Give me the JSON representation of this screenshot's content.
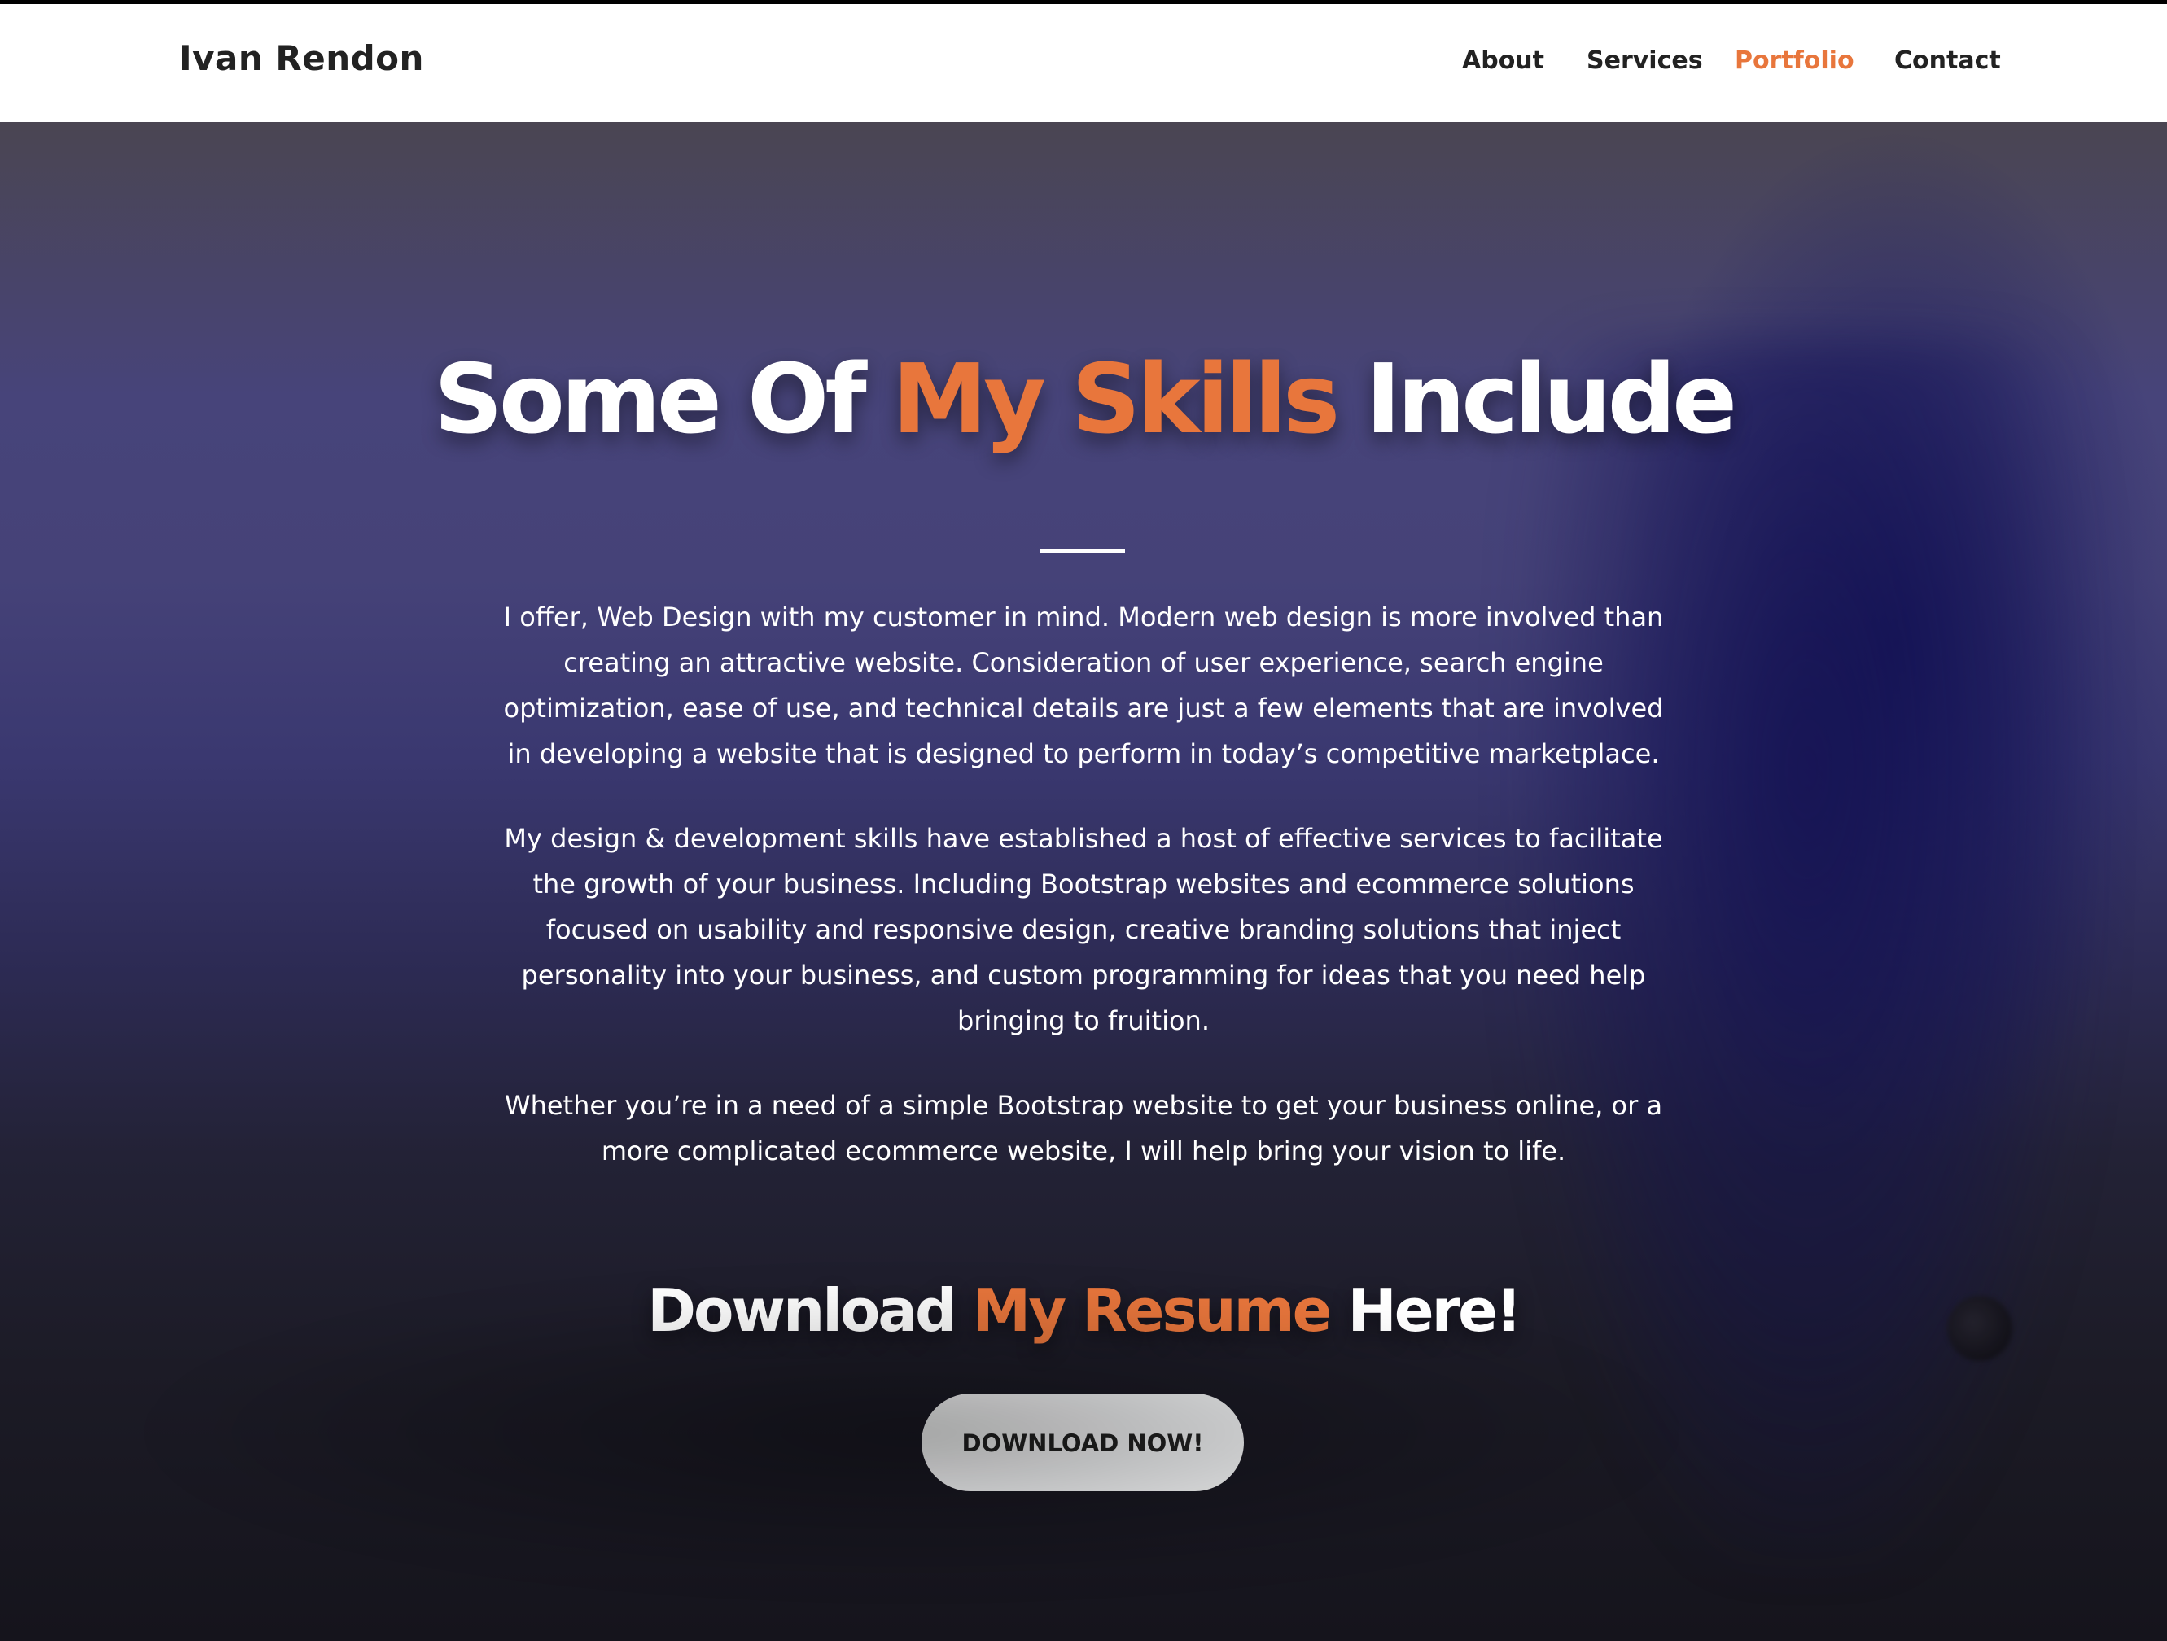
{
  "nav": {
    "brand": "Ivan Rendon",
    "links": [
      {
        "label": "About",
        "active": false
      },
      {
        "label": "Services",
        "active": false
      },
      {
        "label": "Portfolio",
        "active": true
      },
      {
        "label": "Contact",
        "active": false
      }
    ]
  },
  "hero": {
    "heading": {
      "part1": "Some Of ",
      "accent": "My Skills",
      "part2": " Include"
    },
    "paragraphs": [
      "I offer, Web Design with my customer in mind. Modern web design is more involved than creating an attractive website. Consideration of user experience, search engine optimization, ease of use, and technical details are just a few elements that are involved in developing a website that is designed to perform in today’s competitive marketplace.",
      "My design & development skills have established a host of effective services to facilitate the growth of your business. Including Bootstrap websites and ecommerce solutions focused on usability and responsive design, creative branding solutions that inject personality into your business, and custom programming for ideas that you need help bringing to fruition.",
      "Whether you’re in a need of a simple Bootstrap website to get your business online, or a more complicated ecommerce website, I will help bring your vision to life."
    ],
    "resume_heading": {
      "part1": "Download ",
      "accent": "My Resume",
      "part2": " Here!"
    },
    "download_label": "DOWNLOAD NOW!"
  },
  "colors": {
    "accent": "#e8763c",
    "navbar_bg": "#ffffff",
    "text_dark": "#222222",
    "button_bg": "#f8f9fa"
  }
}
